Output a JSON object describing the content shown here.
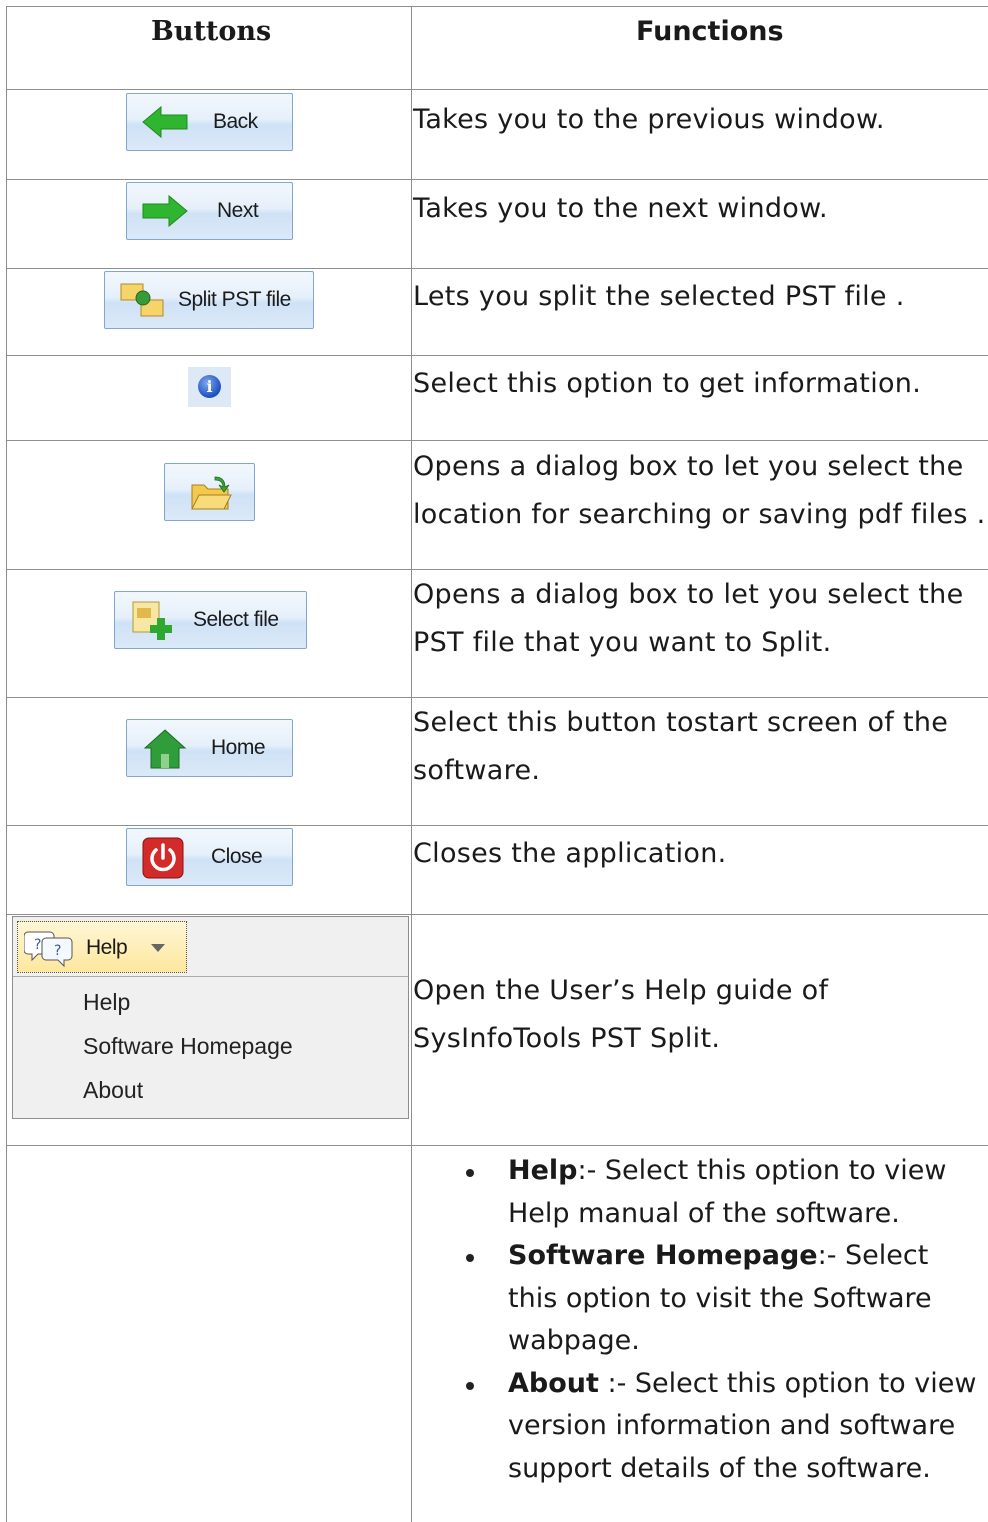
{
  "header": {
    "buttons": "Buttons",
    "functions": "Functions"
  },
  "rows": [
    {
      "button_label": "Back",
      "icon": "arrow-left-icon",
      "function": "Takes you to the previous window."
    },
    {
      "button_label": "Next",
      "icon": "arrow-right-icon",
      "function": "Takes you to the next window."
    },
    {
      "button_label": "Split PST file",
      "icon": "split-file-icon",
      "function": "Lets you split the selected PST file ."
    },
    {
      "button_label": "",
      "icon": "info-icon",
      "function": "Select this option to get information."
    },
    {
      "button_label": "",
      "icon": "folder-open-icon",
      "function": [
        "Opens a dialog box to let you select the",
        "location for searching or saving pdf files ."
      ]
    },
    {
      "button_label": "Select file",
      "icon": "add-file-icon",
      "function": [
        "Opens a dialog box to let you select the",
        "PST file that you want to Split."
      ]
    },
    {
      "button_label": "Home",
      "icon": "home-icon",
      "function": [
        "Select this button tostart screen of the",
        "software."
      ]
    },
    {
      "button_label": "Close",
      "icon": "power-icon",
      "function": "Closes the application."
    },
    {
      "button_label": "Help",
      "icon": "help-icon",
      "function": [
        "Open the User’s Help guide of",
        "SysInfoTools PST Split."
      ]
    }
  ],
  "help_menu": {
    "items": [
      "Help",
      "Software Homepage",
      "About"
    ]
  },
  "help_details": [
    {
      "term": "Help",
      "desc": ":- Select this option to view Help manual of the software."
    },
    {
      "term": "Software Homepage",
      "desc": ":- Select this option to visit the Software wabpage."
    },
    {
      "term": "About",
      "desc": " :- Select this option to view version information and software support details of the software."
    }
  ],
  "colors": {
    "border": "#8f8f8f",
    "button_border": "#7fa7cf",
    "help_button": "#fde79d"
  }
}
